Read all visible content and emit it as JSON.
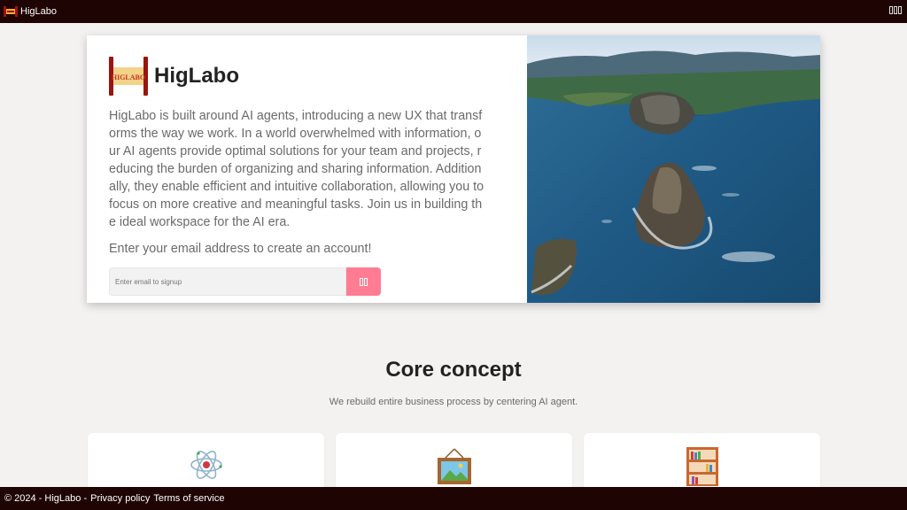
{
  "topbar": {
    "brand": "HigLabo",
    "logo_icon": "higlabo-logo-icon",
    "menu_icon": "menu-icon"
  },
  "hero": {
    "title": "HigLabo",
    "logo_text": "HIGLABO",
    "description": "HigLabo is built around AI agents, introducing a new UX that transforms the way we work. In a world overwhelmed with information, our AI agents provide optimal solutions for your team and projects, reducing the burden of organizing and sharing information. Additionally, they enable efficient and intuitive collaboration, allowing you to focus on more creative and meaningful tasks. Join us in building the ideal workspace for the AI era.",
    "cta": "Enter your email address to create an account!",
    "signup": {
      "placeholder": "Enter email to signup",
      "button_icon": "submit-icon",
      "button_color": "#ff7c93"
    },
    "image": "coastline-aerial-photo"
  },
  "core": {
    "title": "Core concept",
    "subtitle": "We rebuild entire business process by centering AI agent.",
    "cards": [
      {
        "icon": "atom-icon"
      },
      {
        "icon": "framed-picture-icon"
      },
      {
        "icon": "bookshelf-icon"
      }
    ]
  },
  "footer": {
    "copyright": "© 2024 - HigLabo -",
    "privacy_link": "Privacy policy",
    "terms_link": "Terms of service"
  },
  "colors": {
    "bar_background": "#1f0404",
    "page_background": "#f3f2f1",
    "logo_red": "#9b1410",
    "logo_orange": "#f0a93a"
  }
}
